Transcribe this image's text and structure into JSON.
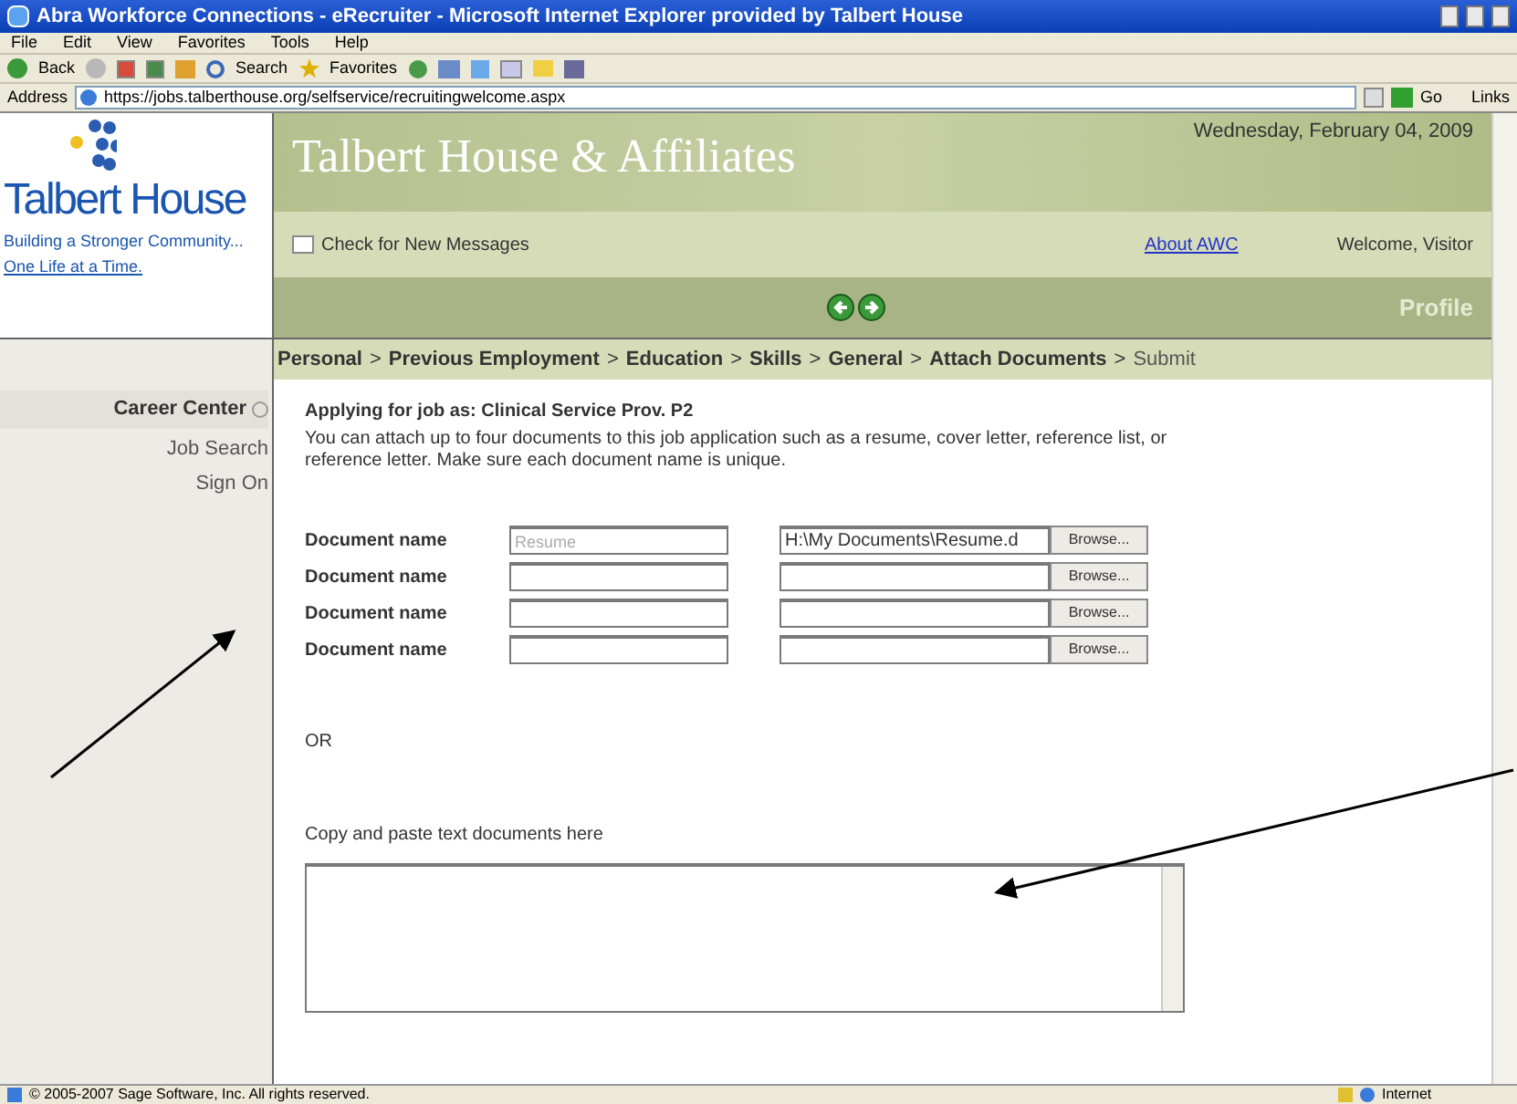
{
  "window": {
    "title": "Abra Workforce Connections - eRecruiter - Microsoft Internet Explorer provided by Talbert House"
  },
  "menu": [
    "File",
    "Edit",
    "View",
    "Favorites",
    "Tools",
    "Help"
  ],
  "toolbar": {
    "back": "Back",
    "search": "Search",
    "favorites": "Favorites"
  },
  "address_bar": {
    "label": "Address",
    "url": "https://jobs.talberthouse.org/selfservice/recruitingwelcome.aspx",
    "go": "Go",
    "links": "Links"
  },
  "logo": {
    "name": "Talbert House",
    "tagline_1": "Building a Stronger Community...",
    "tagline_2": "One Life at a Time."
  },
  "banner": {
    "title": "Talbert House & Affiliates",
    "date": "Wednesday, February 04, 2009"
  },
  "message_bar": {
    "messages": "Check for New Messages",
    "about": "About AWC",
    "welcome": "Welcome, Visitor"
  },
  "nav_bar": {
    "section": "Profile"
  },
  "sidebar": {
    "heading": "Career Center",
    "items": [
      "Job Search",
      "Sign On"
    ]
  },
  "breadcrumb": {
    "separator": ">",
    "steps": [
      {
        "label": "Personal",
        "done": true
      },
      {
        "label": "Previous Employment",
        "done": true
      },
      {
        "label": "Education",
        "done": true
      },
      {
        "label": "Skills",
        "done": true
      },
      {
        "label": "General",
        "done": true
      },
      {
        "label": "Attach Documents",
        "done": true
      },
      {
        "label": "Submit",
        "done": false
      }
    ]
  },
  "form": {
    "heading": "Applying for job as: Clinical Service Prov. P2",
    "intro": "You can attach up to four documents to this job application such as a resume, cover letter, reference list, or reference letter. Make sure each document name is unique.",
    "documents": [
      {
        "label": "Document name",
        "placeholder": "Resume",
        "file": "H:\\My Documents\\Resume.d",
        "browse": "Browse..."
      },
      {
        "label": "Document name",
        "browse": "Browse..."
      },
      {
        "label": "Document name",
        "browse": "Browse..."
      },
      {
        "label": "Document name",
        "browse": "Browse..."
      }
    ],
    "or": "OR",
    "paste_label": "Copy and paste text documents here"
  },
  "status_bar": {
    "text": "© 2005-2007 Sage Software, Inc. All rights reserved.",
    "zone": "Internet"
  }
}
